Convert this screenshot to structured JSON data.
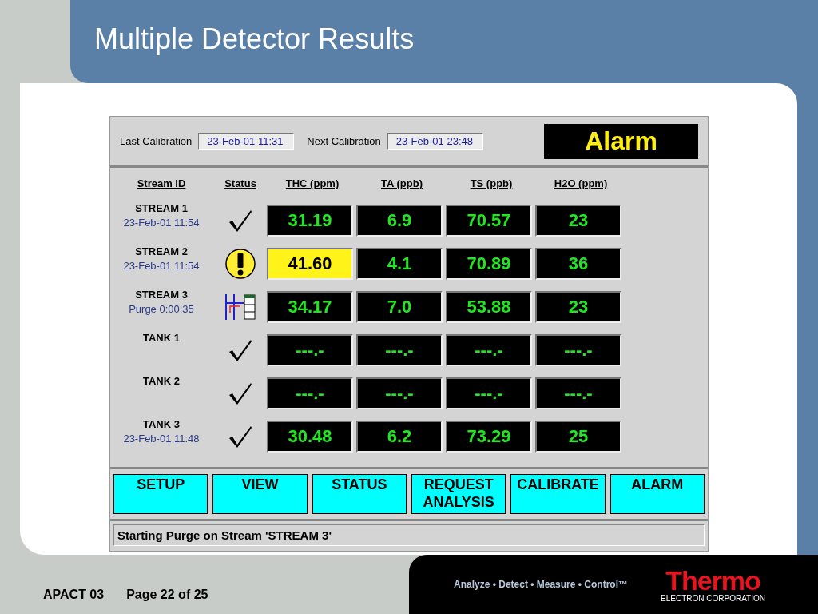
{
  "slide": {
    "title": "Multiple Detector Results"
  },
  "app": {
    "last_calibration": {
      "label": "Last Calibration",
      "value": "23-Feb-01 11:31"
    },
    "next_calibration": {
      "label": "Next Calibration",
      "value": "23-Feb-01 23:48"
    },
    "alarm_display": "Alarm",
    "columns": [
      "Stream ID",
      "Status",
      "THC (ppm)",
      "TA (ppb)",
      "TS (ppb)",
      "H2O (ppm)"
    ],
    "rows": [
      {
        "name": "STREAM 1",
        "detail": "23-Feb-01 11:54",
        "status": {
          "kind": "ok"
        },
        "values": [
          {
            "text": "31.19",
            "alarm": false
          },
          {
            "text": "6.9",
            "alarm": false
          },
          {
            "text": "70.57",
            "alarm": false
          },
          {
            "text": "23",
            "alarm": false
          }
        ]
      },
      {
        "name": "STREAM 2",
        "detail": "23-Feb-01 11:54",
        "status": {
          "kind": "alert"
        },
        "values": [
          {
            "text": "41.60",
            "alarm": true
          },
          {
            "text": "4.1",
            "alarm": false
          },
          {
            "text": "70.89",
            "alarm": false
          },
          {
            "text": "36",
            "alarm": false
          }
        ]
      },
      {
        "name": "STREAM 3",
        "detail": "Purge 0:00:35",
        "status": {
          "kind": "purge"
        },
        "values": [
          {
            "text": "34.17",
            "alarm": false
          },
          {
            "text": "7.0",
            "alarm": false
          },
          {
            "text": "53.88",
            "alarm": false
          },
          {
            "text": "23",
            "alarm": false
          }
        ]
      },
      {
        "name": "TANK 1",
        "status": {
          "kind": "ok"
        },
        "values": [
          {
            "text": "---.-",
            "alarm": false
          },
          {
            "text": "---.-",
            "alarm": false
          },
          {
            "text": "---.-",
            "alarm": false
          },
          {
            "text": "---.-",
            "alarm": false
          }
        ]
      },
      {
        "name": "TANK 2",
        "status": {
          "kind": "ok"
        },
        "values": [
          {
            "text": "---.-",
            "alarm": false
          },
          {
            "text": "---.-",
            "alarm": false
          },
          {
            "text": "---.-",
            "alarm": false
          },
          {
            "text": "---.-",
            "alarm": false
          }
        ]
      },
      {
        "name": "TANK 3",
        "detail": "23-Feb-01 11:48",
        "status": {
          "kind": "ok"
        },
        "values": [
          {
            "text": "30.48",
            "alarm": false
          },
          {
            "text": "6.2",
            "alarm": false
          },
          {
            "text": "73.29",
            "alarm": false
          },
          {
            "text": "25",
            "alarm": false
          }
        ]
      }
    ],
    "buttons": [
      "SETUP",
      "VIEW",
      "STATUS",
      "REQUEST ANALYSIS",
      "CALIBRATE",
      "ALARM"
    ],
    "status_bar": "Starting Purge on Stream 'STREAM 3'"
  },
  "footer": {
    "document": "APACT 03",
    "page": "Page 22 of 25",
    "tagline": "Analyze • Detect • Measure • Control™",
    "logo": "Thermo",
    "logo_subtitle": "ELECTRON CORPORATION"
  }
}
